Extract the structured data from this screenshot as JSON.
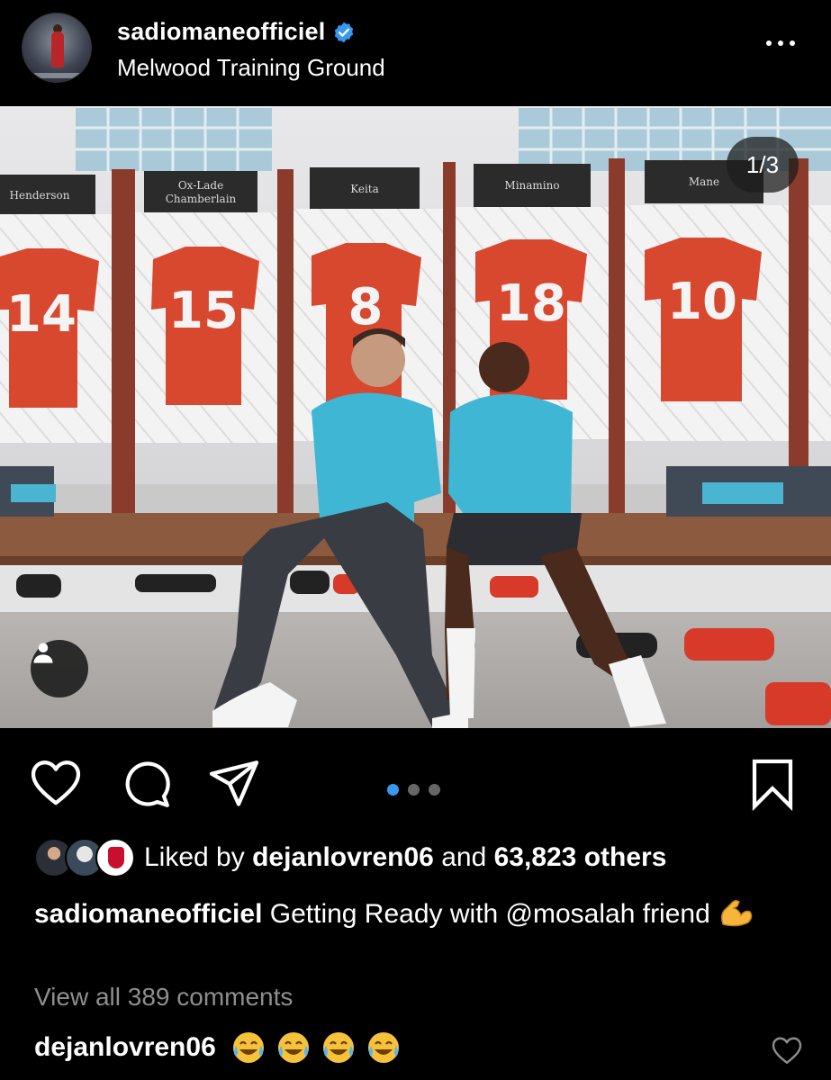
{
  "header": {
    "username": "sadiomaneofficiel",
    "location": "Melwood Training Ground",
    "verified": true
  },
  "photo": {
    "counter": "1/3",
    "lockers": [
      {
        "name": "Henderson",
        "number": "14"
      },
      {
        "name": "Ox-Lade Chamberlain",
        "number": "15"
      },
      {
        "name": "Keita",
        "number": "8"
      },
      {
        "name": "Minamino",
        "number": "18"
      },
      {
        "name": "Mane",
        "number": "10"
      }
    ]
  },
  "carousel": {
    "total": 3,
    "active": 0
  },
  "likes": {
    "prefix": "Liked by",
    "user": "dejanlovren06",
    "middle": "and",
    "count": "63,823 others"
  },
  "caption": {
    "user": "sadiomaneofficiel",
    "text": "Getting Ready with @mosalah friend"
  },
  "comments": {
    "view_all": "View all 389 comments"
  },
  "comment": {
    "user": "dejanlovren06",
    "emoji_count": 4
  },
  "colors": {
    "accent": "#3897f0",
    "background": "#000000",
    "muted": "#8e8e8e",
    "verified": "#3897f0"
  }
}
